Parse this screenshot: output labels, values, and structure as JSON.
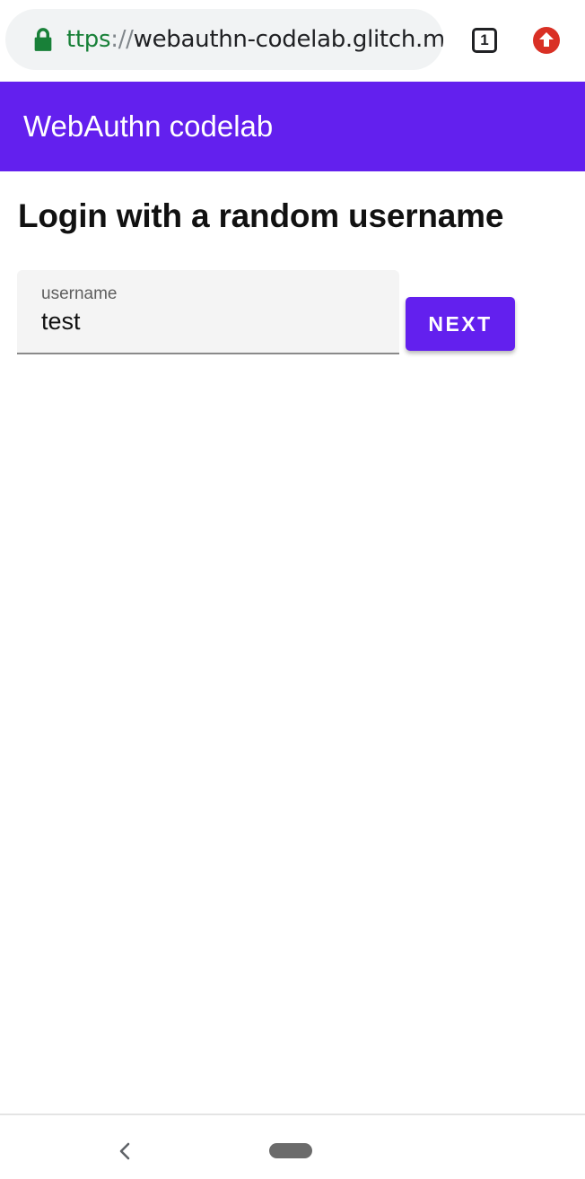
{
  "browser": {
    "url_scheme": "ttps",
    "url_separator": "://",
    "url_host": "webauthn-codelab.glitch.me",
    "tab_count": "1",
    "icons": {
      "lock": "lock-icon",
      "tabs": "tab-count-icon",
      "update": "update-icon"
    },
    "colors": {
      "secure": "#188038",
      "update": "#d93025"
    }
  },
  "app_bar": {
    "title": "WebAuthn codelab",
    "color": "#6320ee"
  },
  "main": {
    "heading": "Login with a random username",
    "username_field": {
      "label": "username",
      "value": "test"
    },
    "next_label": "NEXT"
  },
  "nav": {
    "icons": [
      "back-icon",
      "home-pill"
    ]
  }
}
